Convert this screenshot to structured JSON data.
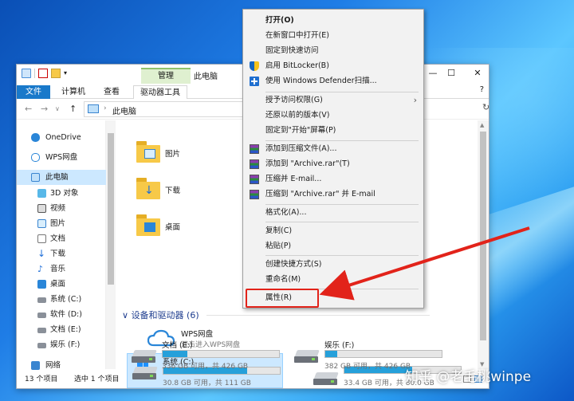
{
  "window": {
    "title": "此电脑",
    "manage_tab": "管理",
    "controls": {
      "minimize": "—",
      "maximize": "☐",
      "close": "✕"
    }
  },
  "ribbon": {
    "tabs": [
      "文件",
      "计算机",
      "查看",
      "驱动器工具"
    ],
    "right_icon": "?"
  },
  "address": {
    "path": "此电脑",
    "back": "←",
    "forward": "→",
    "dropdown": "∨",
    "up": "↑",
    "refresh": "↻"
  },
  "sidebar": {
    "items": [
      {
        "label": "OneDrive",
        "icon": "onedrive-icon"
      },
      {
        "label": "WPS网盘",
        "icon": "wps-cloud-icon"
      },
      {
        "label": "此电脑",
        "icon": "this-pc-icon"
      },
      {
        "label": "3D 对象",
        "icon": "3d-objects-icon"
      },
      {
        "label": "视频",
        "icon": "videos-icon"
      },
      {
        "label": "图片",
        "icon": "pictures-icon"
      },
      {
        "label": "文档",
        "icon": "documents-icon"
      },
      {
        "label": "下载",
        "icon": "downloads-icon"
      },
      {
        "label": "音乐",
        "icon": "music-icon"
      },
      {
        "label": "桌面",
        "icon": "desktop-icon"
      },
      {
        "label": "系统 (C:)",
        "icon": "drive-icon"
      },
      {
        "label": "软件 (D:)",
        "icon": "drive-icon"
      },
      {
        "label": "文档 (E:)",
        "icon": "drive-icon"
      },
      {
        "label": "娱乐 (F:)",
        "icon": "drive-icon"
      },
      {
        "label": "网络",
        "icon": "network-icon"
      }
    ]
  },
  "folders": [
    {
      "label": "图片"
    },
    {
      "label": "下载"
    },
    {
      "label": "桌面"
    }
  ],
  "devices_section": {
    "title": "设备和驱动器 (6)",
    "chevron": "∨"
  },
  "wps_drive": {
    "name": "WPS网盘",
    "desc": "双击进入WPS网盘"
  },
  "drives": [
    {
      "name": "系统 (C:)",
      "space": "30.8 GB 可用，共 111 GB",
      "used_fraction": 0.72,
      "selected": true
    },
    {
      "name": "",
      "space": "33.4 GB 可用，共 80.0 GB",
      "used_fraction": 0.58,
      "selected": false
    },
    {
      "name": "文档 (E:)",
      "space": "336 GB 可用，共 426 GB",
      "used_fraction": 0.21,
      "selected": false
    },
    {
      "name": "娱乐 (F:)",
      "space": "382 GB 可用，共 426 GB",
      "used_fraction": 0.1,
      "selected": false
    }
  ],
  "status": {
    "count": "13 个项目",
    "selected": "选中 1 个项目"
  },
  "context_menu": {
    "items": [
      {
        "label": "打开(O)",
        "bold": true
      },
      {
        "label": "在新窗口中打开(E)"
      },
      {
        "label": "固定到快速访问"
      },
      {
        "label": "启用 BitLocker(B)",
        "icon": "bitlocker-shield-icon"
      },
      {
        "label": "使用 Windows Defender扫描...",
        "icon": "defender-icon"
      },
      {
        "label": "授予访问权限(G)",
        "submenu": "›"
      },
      {
        "label": "还原以前的版本(V)"
      },
      {
        "label": "固定到\"开始\"屏幕(P)"
      },
      {
        "label": "添加到压缩文件(A)...",
        "icon": "winrar-icon"
      },
      {
        "label": "添加到 \"Archive.rar\"(T)",
        "icon": "winrar-icon"
      },
      {
        "label": "压缩并 E-mail...",
        "icon": "winrar-icon"
      },
      {
        "label": "压缩到 \"Archive.rar\" 并 E-mail",
        "icon": "winrar-icon"
      },
      {
        "label": "格式化(A)..."
      },
      {
        "label": "复制(C)"
      },
      {
        "label": "粘贴(P)"
      },
      {
        "label": "创建快捷方式(S)"
      },
      {
        "label": "重命名(M)"
      },
      {
        "label": "属性(R)"
      }
    ]
  },
  "annotation": {
    "color": "#e2231a"
  },
  "watermark": "知乎 @老毛桃winpe",
  "colors": {
    "accent": "#1979ca",
    "selection": "#cce8ff",
    "drive_fill": "#26a0da"
  }
}
